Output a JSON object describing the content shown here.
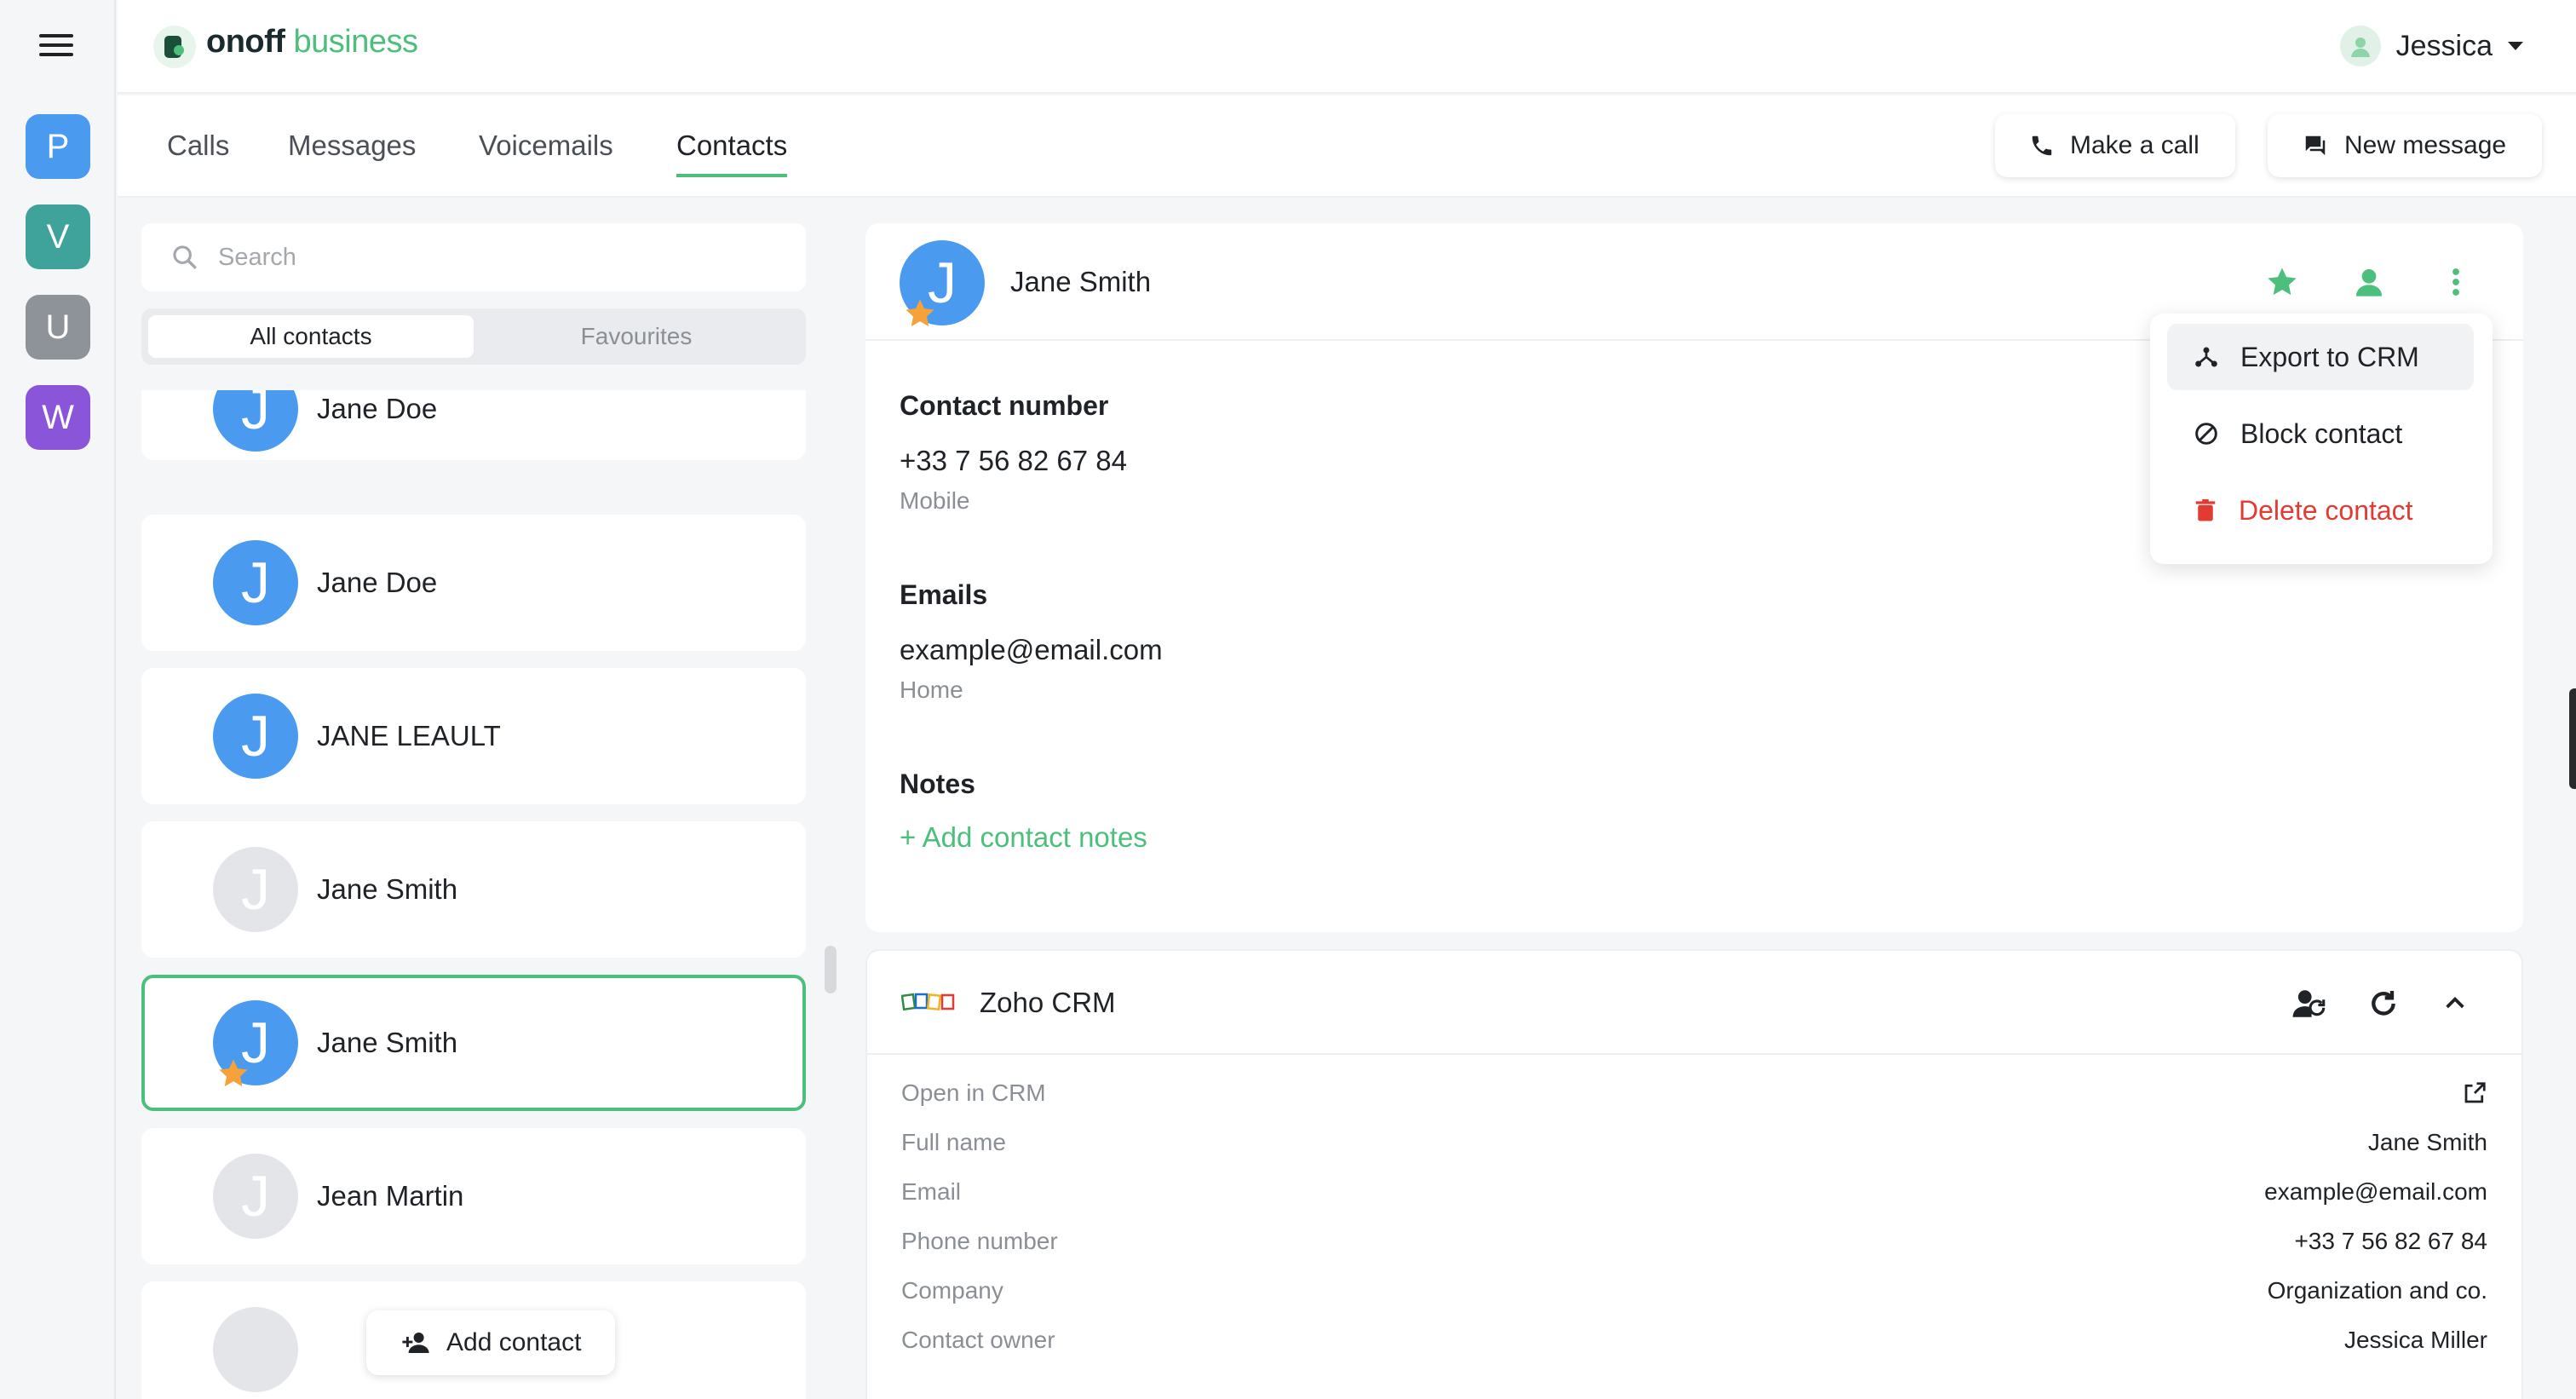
{
  "colors": {
    "brand_green": "#4cbf7c",
    "avatar_blue": "#4a9af0",
    "danger_red": "#e23b32",
    "star_orange": "#f5a23a"
  },
  "header": {
    "logo_bold": "onoff",
    "logo_light": "business",
    "user_name": "Jessica"
  },
  "workspaces": [
    {
      "letter": "P",
      "color": "#4a9af0"
    },
    {
      "letter": "V",
      "color": "#3fa39b"
    },
    {
      "letter": "U",
      "color": "#8e9399"
    },
    {
      "letter": "W",
      "color": "#8b55d9"
    }
  ],
  "tabs": [
    {
      "label": "Calls"
    },
    {
      "label": "Messages"
    },
    {
      "label": "Voicemails"
    },
    {
      "label": "Contacts",
      "active": true
    }
  ],
  "actions": {
    "make_call": "Make a call",
    "new_message": "New message",
    "add_contact": "Add contact"
  },
  "search": {
    "placeholder": "Search"
  },
  "filter": {
    "all": "All contacts",
    "favourites": "Favourites",
    "selected": "All contacts"
  },
  "contacts": [
    {
      "initial": "J",
      "name": "Jane Doe",
      "avatar": "blue"
    },
    {
      "initial": "J",
      "name": "Jane Doe",
      "avatar": "blue"
    },
    {
      "initial": "J",
      "name": "JANE LEAULT",
      "avatar": "blue"
    },
    {
      "initial": "J",
      "name": "Jane Smith",
      "avatar": "grey"
    },
    {
      "initial": "J",
      "name": "Jane Smith",
      "avatar": "blue",
      "favourite": true,
      "selected": true
    },
    {
      "initial": "J",
      "name": "Jean Martin",
      "avatar": "grey"
    }
  ],
  "detail": {
    "initial": "J",
    "name": "Jane Smith",
    "contact_number_title": "Contact number",
    "phone": "+33 7 56 82 67 84",
    "phone_type": "Mobile",
    "emails_title": "Emails",
    "email": "example@email.com",
    "email_type": "Home",
    "notes_title": "Notes",
    "add_notes": "+ Add contact notes"
  },
  "menu": {
    "export": "Export to CRM",
    "block": "Block contact",
    "delete": "Delete contact"
  },
  "crm": {
    "title": "Zoho CRM",
    "rows": [
      {
        "label": "Open in CRM",
        "value": ""
      },
      {
        "label": "Full name",
        "value": "Jane Smith"
      },
      {
        "label": "Email",
        "value": "example@email.com"
      },
      {
        "label": "Phone number",
        "value": "+33 7 56 82 67 84"
      },
      {
        "label": "Company",
        "value": "Organization and co."
      },
      {
        "label": "Contact owner",
        "value": "Jessica Miller"
      }
    ]
  }
}
